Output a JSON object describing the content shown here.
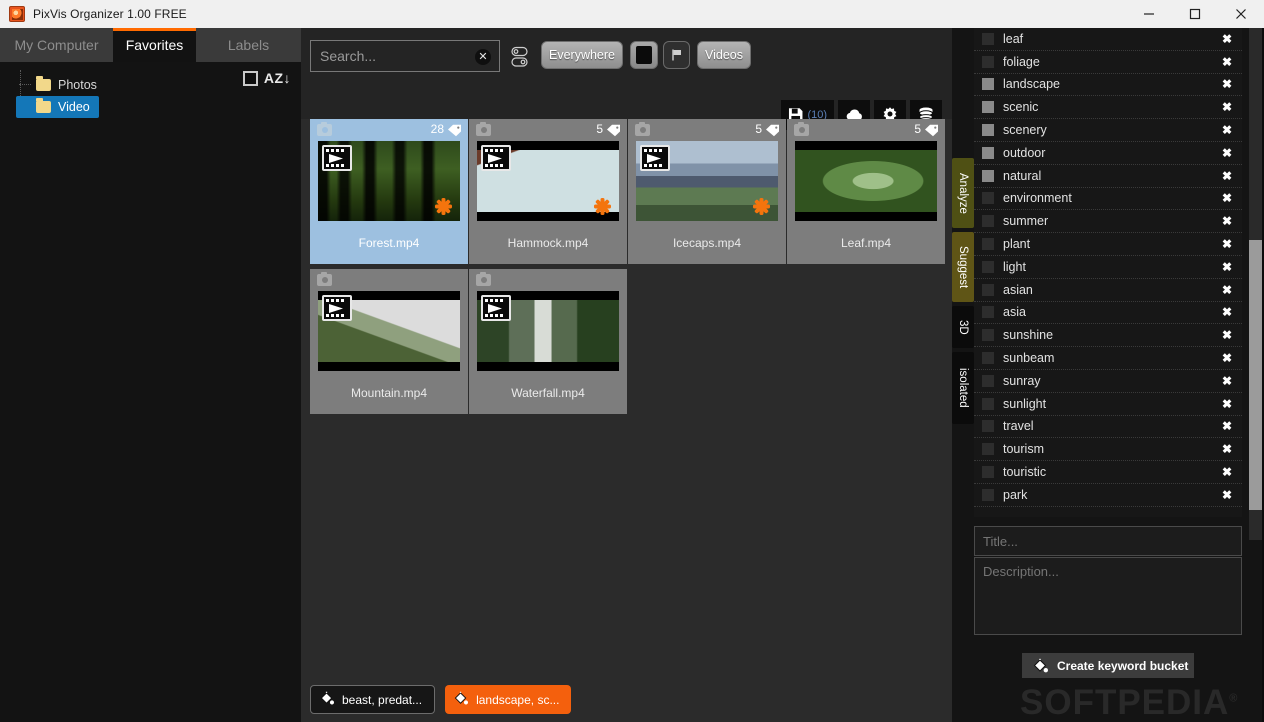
{
  "window": {
    "title": "PixVis Organizer 1.00 FREE",
    "minimize": "—",
    "maximize": "□",
    "close": "✕"
  },
  "tabs": [
    {
      "label": "My Computer",
      "active": false
    },
    {
      "label": "Favorites",
      "active": true
    },
    {
      "label": "Labels",
      "active": false
    }
  ],
  "tree": {
    "sort_label": "AZ",
    "sort_arrow": "↓",
    "items": [
      {
        "label": "Photos",
        "selected": false
      },
      {
        "label": "Video",
        "selected": true
      }
    ]
  },
  "toolbar": {
    "search_placeholder": "Search...",
    "search_value": "",
    "clear_label": "✕",
    "everywhere_label": "Everywhere",
    "videos_label": "Videos",
    "save_count": "(10)"
  },
  "grid": {
    "items": [
      {
        "name": "Forest.mp4",
        "tags": "28",
        "selected": true,
        "play": true,
        "star": true,
        "letterbox": false,
        "img": "img-forest"
      },
      {
        "name": "Hammock.mp4",
        "tags": "5",
        "selected": false,
        "play": true,
        "star": true,
        "letterbox": true,
        "img": "img-hammock"
      },
      {
        "name": "Icecaps.mp4",
        "tags": "5",
        "selected": false,
        "play": true,
        "star": true,
        "letterbox": false,
        "img": "img-icecaps"
      },
      {
        "name": "Leaf.mp4",
        "tags": "5",
        "selected": false,
        "play": false,
        "star": false,
        "letterbox": true,
        "img": "img-leaf"
      },
      {
        "name": "Mountain.mp4",
        "tags": "",
        "selected": false,
        "play": true,
        "star": false,
        "letterbox": true,
        "img": "img-mountain"
      },
      {
        "name": "Waterfall.mp4",
        "tags": "",
        "selected": false,
        "play": true,
        "star": false,
        "letterbox": true,
        "img": "img-waterfall"
      }
    ]
  },
  "buckets": [
    {
      "label": "beast, predat...",
      "active": false
    },
    {
      "label": "landscape, sc...",
      "active": true
    }
  ],
  "vtabs": [
    {
      "label": "Analyze",
      "style": "analyze"
    },
    {
      "label": "Suggest",
      "style": "suggest"
    },
    {
      "label": "3D",
      "style": "threed"
    },
    {
      "label": "isolated",
      "style": "isolated"
    }
  ],
  "keywords": {
    "delete_label": "✖",
    "items": [
      {
        "label": "leaf",
        "checked": false
      },
      {
        "label": "foliage",
        "checked": false
      },
      {
        "label": "landscape",
        "checked": true
      },
      {
        "label": "scenic",
        "checked": true
      },
      {
        "label": "scenery",
        "checked": true
      },
      {
        "label": "outdoor",
        "checked": true
      },
      {
        "label": "natural",
        "checked": true
      },
      {
        "label": "environment",
        "checked": false
      },
      {
        "label": "summer",
        "checked": false
      },
      {
        "label": "plant",
        "checked": false
      },
      {
        "label": "light",
        "checked": false
      },
      {
        "label": "asian",
        "checked": false
      },
      {
        "label": "asia",
        "checked": false
      },
      {
        "label": "sunshine",
        "checked": false
      },
      {
        "label": "sunbeam",
        "checked": false
      },
      {
        "label": "sunray",
        "checked": false
      },
      {
        "label": "sunlight",
        "checked": false
      },
      {
        "label": "travel",
        "checked": false
      },
      {
        "label": "tourism",
        "checked": false
      },
      {
        "label": "touristic",
        "checked": false
      },
      {
        "label": "park",
        "checked": false
      }
    ]
  },
  "meta": {
    "title_placeholder": "Title...",
    "title_value": "",
    "description_placeholder": "Description...",
    "description_value": "",
    "create_bucket_label": "Create keyword bucket"
  },
  "watermark": {
    "text": "SOFTPEDIA",
    "mark": "®"
  },
  "colors": {
    "accent": "#ff6a00",
    "bucket_active": "#f4600d",
    "selection": "#9dc0e0",
    "tree_selection": "#1477b8",
    "analyze_tab": "#4f5014",
    "suggest_tab": "#5f5516"
  }
}
